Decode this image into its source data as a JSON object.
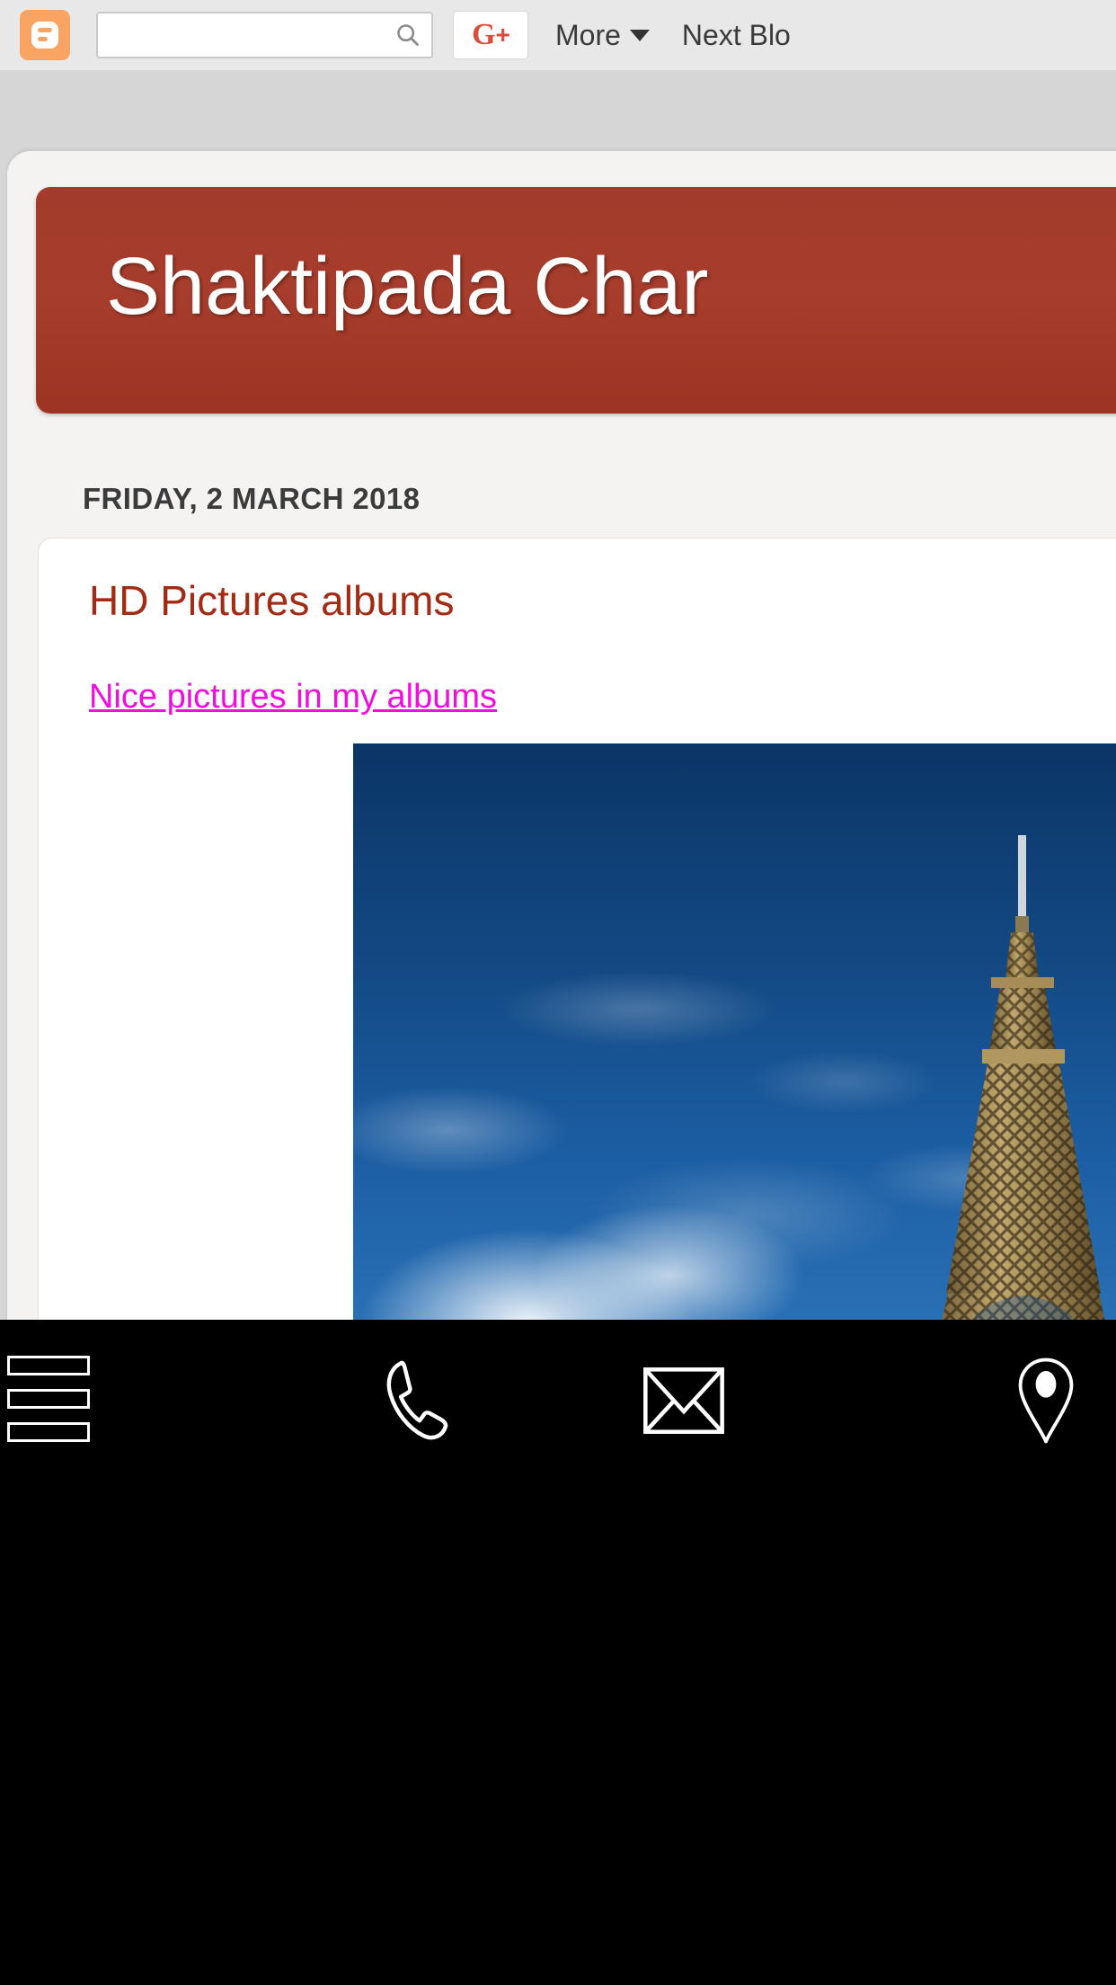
{
  "navbar": {
    "logo_icon": "blogger-logo-icon",
    "search_value": "",
    "search_placeholder": "",
    "search_icon": "search-icon",
    "gplus_g": "G",
    "gplus_plus": "+",
    "more_label": "More",
    "caret_icon": "chevron-down-icon",
    "next_blog_label": "Next Blo"
  },
  "header": {
    "blog_title": "Shaktipada Char"
  },
  "post": {
    "date": "FRIDAY, 2 MARCH 2018",
    "title": "HD Pictures albums",
    "link_text": "Nice pictures in my albums ",
    "image_alt": "eiffel-tower-photo"
  },
  "bottom_toolbar": {
    "items": [
      {
        "name": "menu-icon",
        "label": "Menu"
      },
      {
        "name": "phone-icon",
        "label": "Call"
      },
      {
        "name": "email-icon",
        "label": "Email"
      },
      {
        "name": "location-icon",
        "label": "Map"
      }
    ]
  },
  "colors": {
    "navbar_bg": "#e8e8e8",
    "blogger_orange": "#f9a463",
    "gplus_red": "#dd4b39",
    "banner_red": "#a23b2b",
    "post_title_red": "#a32b14",
    "link_magenta": "#f20ce0",
    "page_gray": "#d6d6d6",
    "panel_gray": "#f4f3f1",
    "toolbar_black": "#000000"
  }
}
